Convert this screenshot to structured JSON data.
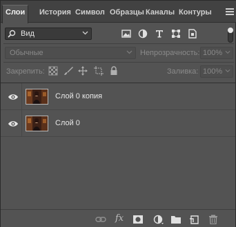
{
  "tabs": [
    {
      "label": "Слои",
      "active": true
    },
    {
      "label": "История"
    },
    {
      "label": "Символ"
    },
    {
      "label": "Образцы"
    },
    {
      "label": "Каналы"
    },
    {
      "label": "Контуры"
    }
  ],
  "filter": {
    "value": "Вид",
    "icons": [
      "image-filter-icon",
      "adjustment-filter-icon",
      "type-filter-icon",
      "shape-filter-icon",
      "smart-object-filter-icon"
    ]
  },
  "blend": {
    "mode": "Обычные",
    "opacity_label": "Непрозрачность:",
    "opacity_value": "100%"
  },
  "lock": {
    "label": "Закрепить:",
    "icons": [
      "lock-transparent-pixels-icon",
      "lock-image-pixels-icon",
      "lock-position-icon",
      "lock-artboard-icon",
      "lock-all-icon"
    ],
    "fill_label": "Заливка:",
    "fill_value": "100%"
  },
  "layers": [
    {
      "name": "Слой 0 копия",
      "visible": true
    },
    {
      "name": "Слой 0",
      "visible": true
    }
  ],
  "bottom_toolbar": {
    "icons": [
      "link-layers-icon",
      "layer-style-icon",
      "add-mask-icon",
      "new-adjustment-icon",
      "new-group-icon",
      "new-layer-icon",
      "delete-layer-icon"
    ],
    "fx_label": "fx"
  },
  "colors": {
    "panel_bg": "#535353",
    "tabbar_bg": "#424242",
    "text": "#e8e8e8",
    "dim_text": "#8a8a8a"
  }
}
